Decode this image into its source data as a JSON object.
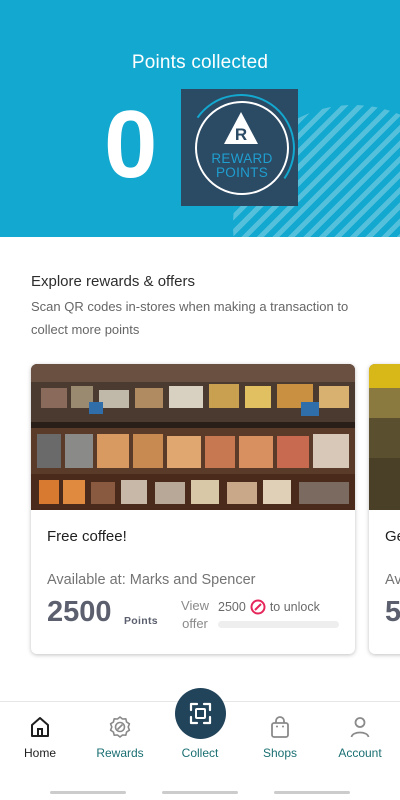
{
  "header": {
    "title": "Points collected",
    "points": "0",
    "badge_line1": "REWARD",
    "badge_line2": "POINTS",
    "badge_logo": "reward-points-logo"
  },
  "section": {
    "title": "Explore rewards & offers",
    "description": "Scan QR codes in-stores when making a transaction to collect more points"
  },
  "offers": [
    {
      "title": "Free coffee!",
      "available": "Available at: Marks and Spencer",
      "points": "2500",
      "points_label": "Points",
      "view_offer": "View offer",
      "unlock_points": "2500",
      "unlock_label": "to unlock",
      "progress": 0.0
    },
    {
      "title": "Ge",
      "available": "Av",
      "points": "5"
    }
  ],
  "nav": {
    "items": [
      {
        "label": "Home",
        "icon": "home-icon"
      },
      {
        "label": "Rewards",
        "icon": "rewards-badge-icon"
      },
      {
        "label": "Shops",
        "icon": "shopping-bag-icon"
      },
      {
        "label": "Account",
        "icon": "account-icon"
      }
    ],
    "collect_label": "Collect",
    "collect_icon": "scan-icon"
  },
  "colors": {
    "header": "#13a8cf",
    "badge": "#2b4a64",
    "nav_accent": "#1a6f72",
    "unlock_accent": "#e6265b"
  }
}
